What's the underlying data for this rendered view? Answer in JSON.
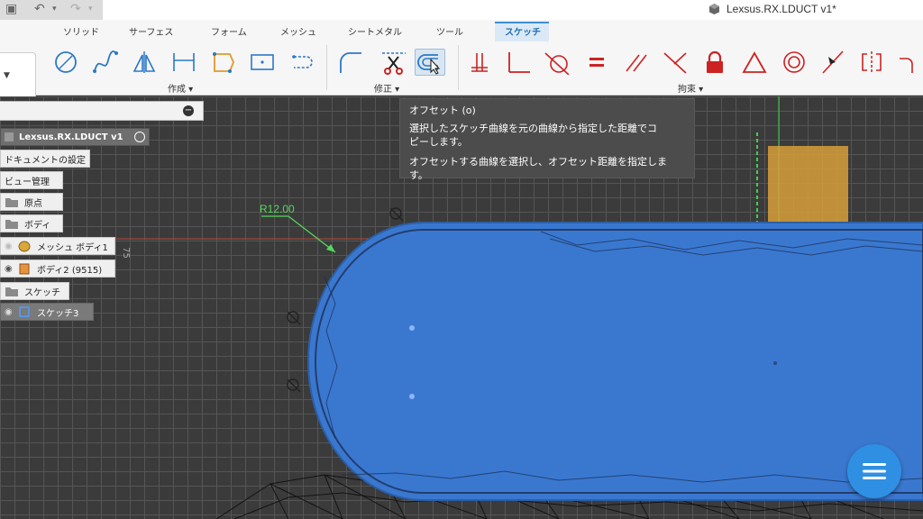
{
  "app": {
    "document_title": "Lexsus.RX.LDUCT v1*"
  },
  "ribbon": {
    "tabs": [
      "ソリッド",
      "サーフェス",
      "フォーム",
      "メッシュ",
      "シートメタル",
      "ツール",
      "スケッチ"
    ],
    "active_tab": "スケッチ",
    "groups": {
      "create": "作成 ▾",
      "modify": "修正 ▾",
      "constrain": "拘束 ▾"
    }
  },
  "tooltip": {
    "title": "オフセット (o)",
    "line1": "選択したスケッチ曲線を元の曲線から指定した距離でコ",
    "line2": "ピーします。",
    "line3": "オフセットする曲線を選択し、オフセット距離を指定します。"
  },
  "browser": {
    "root": "Lexsus.RX.LDUCT v1",
    "items": [
      "ドキュメントの設定",
      "ビュー管理",
      "原点",
      "ボディ",
      "メッシュ ボディ1",
      "ボディ2 (9515)",
      "スケッチ",
      "スケッチ3"
    ]
  },
  "canvas": {
    "dimension_label": "R12.00",
    "axis_label": "75"
  },
  "colors": {
    "accent": "#3d8fd6",
    "body_fill": "#3a78d0",
    "grid": "#555555",
    "fab": "#2f8fe3"
  }
}
